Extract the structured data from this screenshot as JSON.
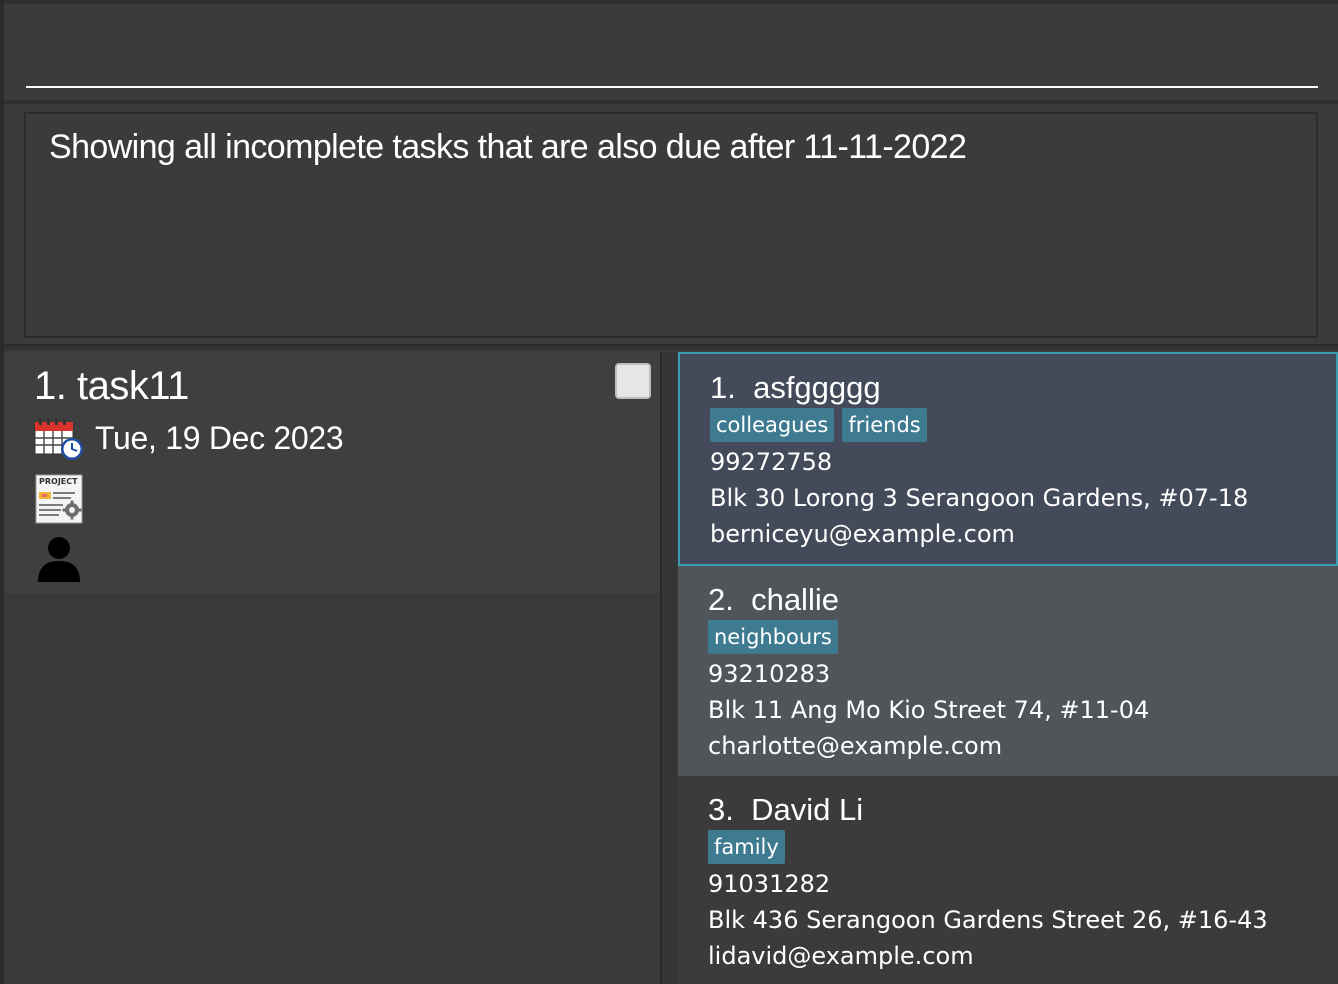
{
  "command_box": {
    "value": "",
    "placeholder": ""
  },
  "result_display": {
    "message": "Showing all incomplete tasks that are also due after 11-11-2022"
  },
  "tasks": [
    {
      "index": "1.",
      "title": "task11",
      "display_title": "1. task11",
      "deadline": "Tue, 19 Dec 2023",
      "completed": false
    }
  ],
  "persons": [
    {
      "display_name": "1.  asfggggg",
      "tags": [
        "colleagues",
        "friends"
      ],
      "phone": "99272758",
      "address": "Blk 30 Lorong 3 Serangoon Gardens, #07-18",
      "email": "berniceyu@example.com"
    },
    {
      "display_name": "2.  challie",
      "tags": [
        "neighbours"
      ],
      "phone": "93210283",
      "address": "Blk 11 Ang Mo Kio Street 74, #11-04",
      "email": "charlotte@example.com"
    },
    {
      "display_name": "3.  David Li",
      "tags": [
        "family"
      ],
      "phone": "91031282",
      "address": "Blk 436 Serangoon Gardens Street 26, #16-43",
      "email": "lidavid@example.com"
    }
  ],
  "icons": {
    "deadline": "calendar-clock-icon",
    "project": "project-document-icon",
    "assignee": "person-icon"
  },
  "colors": {
    "tag": "#3e7b91",
    "selected_border": "#3a9bb0",
    "selected_bg": "#434a5a"
  }
}
